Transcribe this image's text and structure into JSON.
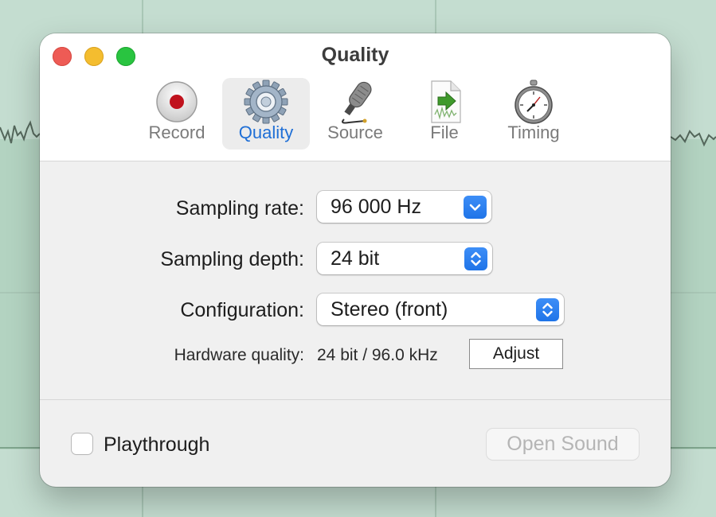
{
  "window": {
    "title": "Quality"
  },
  "tabs": [
    {
      "label": "Record",
      "icon": "record-icon",
      "selected": false
    },
    {
      "label": "Quality",
      "icon": "gear-icon",
      "selected": true
    },
    {
      "label": "Source",
      "icon": "microphone-icon",
      "selected": false
    },
    {
      "label": "File",
      "icon": "file-icon",
      "selected": false
    },
    {
      "label": "Timing",
      "icon": "stopwatch-icon",
      "selected": false
    }
  ],
  "settings": {
    "sampling_rate": {
      "label": "Sampling rate:",
      "value": "96 000 Hz"
    },
    "sampling_depth": {
      "label": "Sampling depth:",
      "value": "24 bit"
    },
    "configuration": {
      "label": "Configuration:",
      "value": "Stereo (front)"
    },
    "hardware_quality": {
      "label": "Hardware quality:",
      "value": "24 bit / 96.0 kHz",
      "adjust_label": "Adjust"
    }
  },
  "footer": {
    "playthrough_label": "Playthrough",
    "playthrough_checked": false,
    "open_sound_label": "Open Sound"
  },
  "colors": {
    "accent": "#1f74e8",
    "selected_tab_text": "#1f6fd6",
    "close": "#ee5b55",
    "minimize": "#f4bd2f",
    "maximize": "#29c440",
    "background": "#c4ddd0"
  }
}
